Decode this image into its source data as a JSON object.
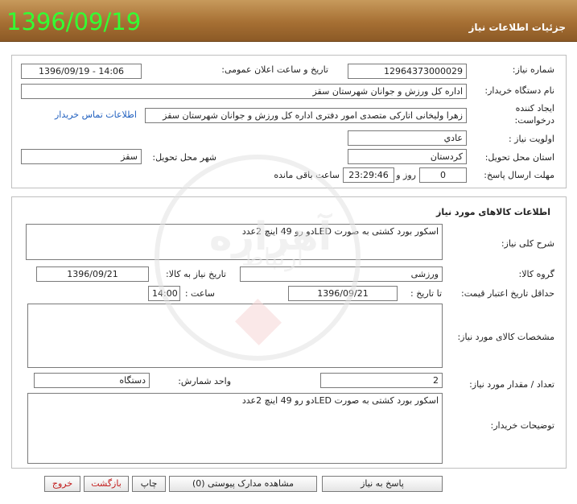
{
  "header": {
    "title": "جزئیات اطلاعات نیاز",
    "date_badge": "1396/09/19"
  },
  "info": {
    "need_number_label": "شماره نیاز:",
    "need_number": "12964373000029",
    "announce_label": "تاریخ و ساعت اعلان عمومی:",
    "announce_value": "1396/09/19 - 14:06",
    "buyer_label": "نام دستگاه خریدار:",
    "buyer_value": "اداره کل ورزش و جوانان شهرستان سقز",
    "creator_label_1": "ایجاد کننده",
    "creator_label_2": "درخواست:",
    "creator_value": "زهرا ولیخانی اتارکی متصدی امور دفتری اداره کل ورزش و جوانان شهرستان سقز",
    "contact_link": "اطلاعات تماس خریدار",
    "priority_label": "اولویت نیاز :",
    "priority_value": "عادي",
    "province_label": "استان محل تحویل:",
    "province_value": "کردستان",
    "city_label": "شهر محل تحویل:",
    "city_value": "سقز",
    "deadline_label": "مهلت ارسال پاسخ:",
    "deadline_days": "0",
    "days_label": "روز و",
    "deadline_time": "23:29:46",
    "remaining_label": "ساعت باقی مانده"
  },
  "goods": {
    "section_title": "اطلاعات کالاهای مورد نیاز",
    "general_desc_label": "شرح کلی نیاز:",
    "general_desc": "اسکور بورد کشتی  به صورت LEDدو رو 49 اینچ  2عدد",
    "group_label": "گروه کالا:",
    "group_value": "ورزشی",
    "need_date_label": "تاریخ نیاز به کالا:",
    "need_date": "1396/09/21",
    "min_price_label": "حداقل تاریخ اعتبار قیمت:",
    "to_date_label": "تا تاریخ :",
    "to_date": "1396/09/21",
    "time_label": "ساعت :",
    "time_value": "14:00",
    "specs_label": "مشخصات کالای مورد نیاز:",
    "specs_value": "",
    "qty_label": "تعداد / مقدار مورد نیاز:",
    "qty_value": "2",
    "unit_label": "واحد شمارش:",
    "unit_value": "دستگاه",
    "buyer_notes_label": "توضیحات خریدار:",
    "buyer_notes": "اسکور بورد کشتی  به صورت LEDدو رو 49 اینچ  2عدد"
  },
  "buttons": {
    "reply": "پاسخ به نیاز",
    "attachments": "مشاهده مدارک پیوستی (0)",
    "print": "چاپ",
    "back": "بازگشت",
    "exit": "خروج"
  },
  "watermark": {
    "main": "آهزاره",
    "sub": "ارتباط"
  }
}
